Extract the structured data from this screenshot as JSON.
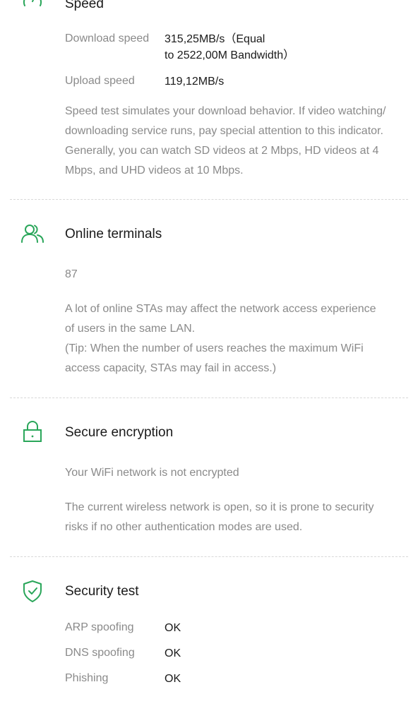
{
  "theme": {
    "accent_color": "#2aa65a",
    "label_color": "#8a8a8a",
    "text_color": "#1a1a1a"
  },
  "speed": {
    "icon": "speedometer-icon",
    "title": "Speed",
    "download_label": "Download speed",
    "download_value_line1": "315,25MB/s（Equal",
    "download_value_line2": "to 2522,00M Bandwidth）",
    "upload_label": "Upload speed",
    "upload_value": "119,12MB/s",
    "description_lines": [
      "Speed test simulates your download behavior. If video watching/",
      "downloading service runs, pay special attention to this indicator.",
      "Generally, you can watch SD videos at 2 Mbps, HD videos at 4",
      "Mbps, and UHD videos at 10 Mbps."
    ]
  },
  "online_terminals": {
    "icon": "users-icon",
    "title": "Online terminals",
    "count": "87",
    "description_lines": [
      "A lot of online STAs may affect the network access experience",
      "of users in the same LAN.",
      "(Tip: When the number of users reaches the maximum WiFi",
      "access capacity, STAs may fail in access.)"
    ]
  },
  "secure_encryption": {
    "icon": "lock-icon",
    "title": "Secure encryption",
    "status": "Your WiFi network is not encrypted",
    "description_lines": [
      "The current wireless network is open, so it is prone to security",
      "risks if no other authentication modes are used."
    ]
  },
  "security_test": {
    "icon": "shield-check-icon",
    "title": "Security test",
    "items": [
      {
        "label": "ARP spoofing",
        "value": "OK"
      },
      {
        "label": "DNS spoofing",
        "value": "OK"
      },
      {
        "label": "Phishing",
        "value": "OK"
      }
    ]
  }
}
